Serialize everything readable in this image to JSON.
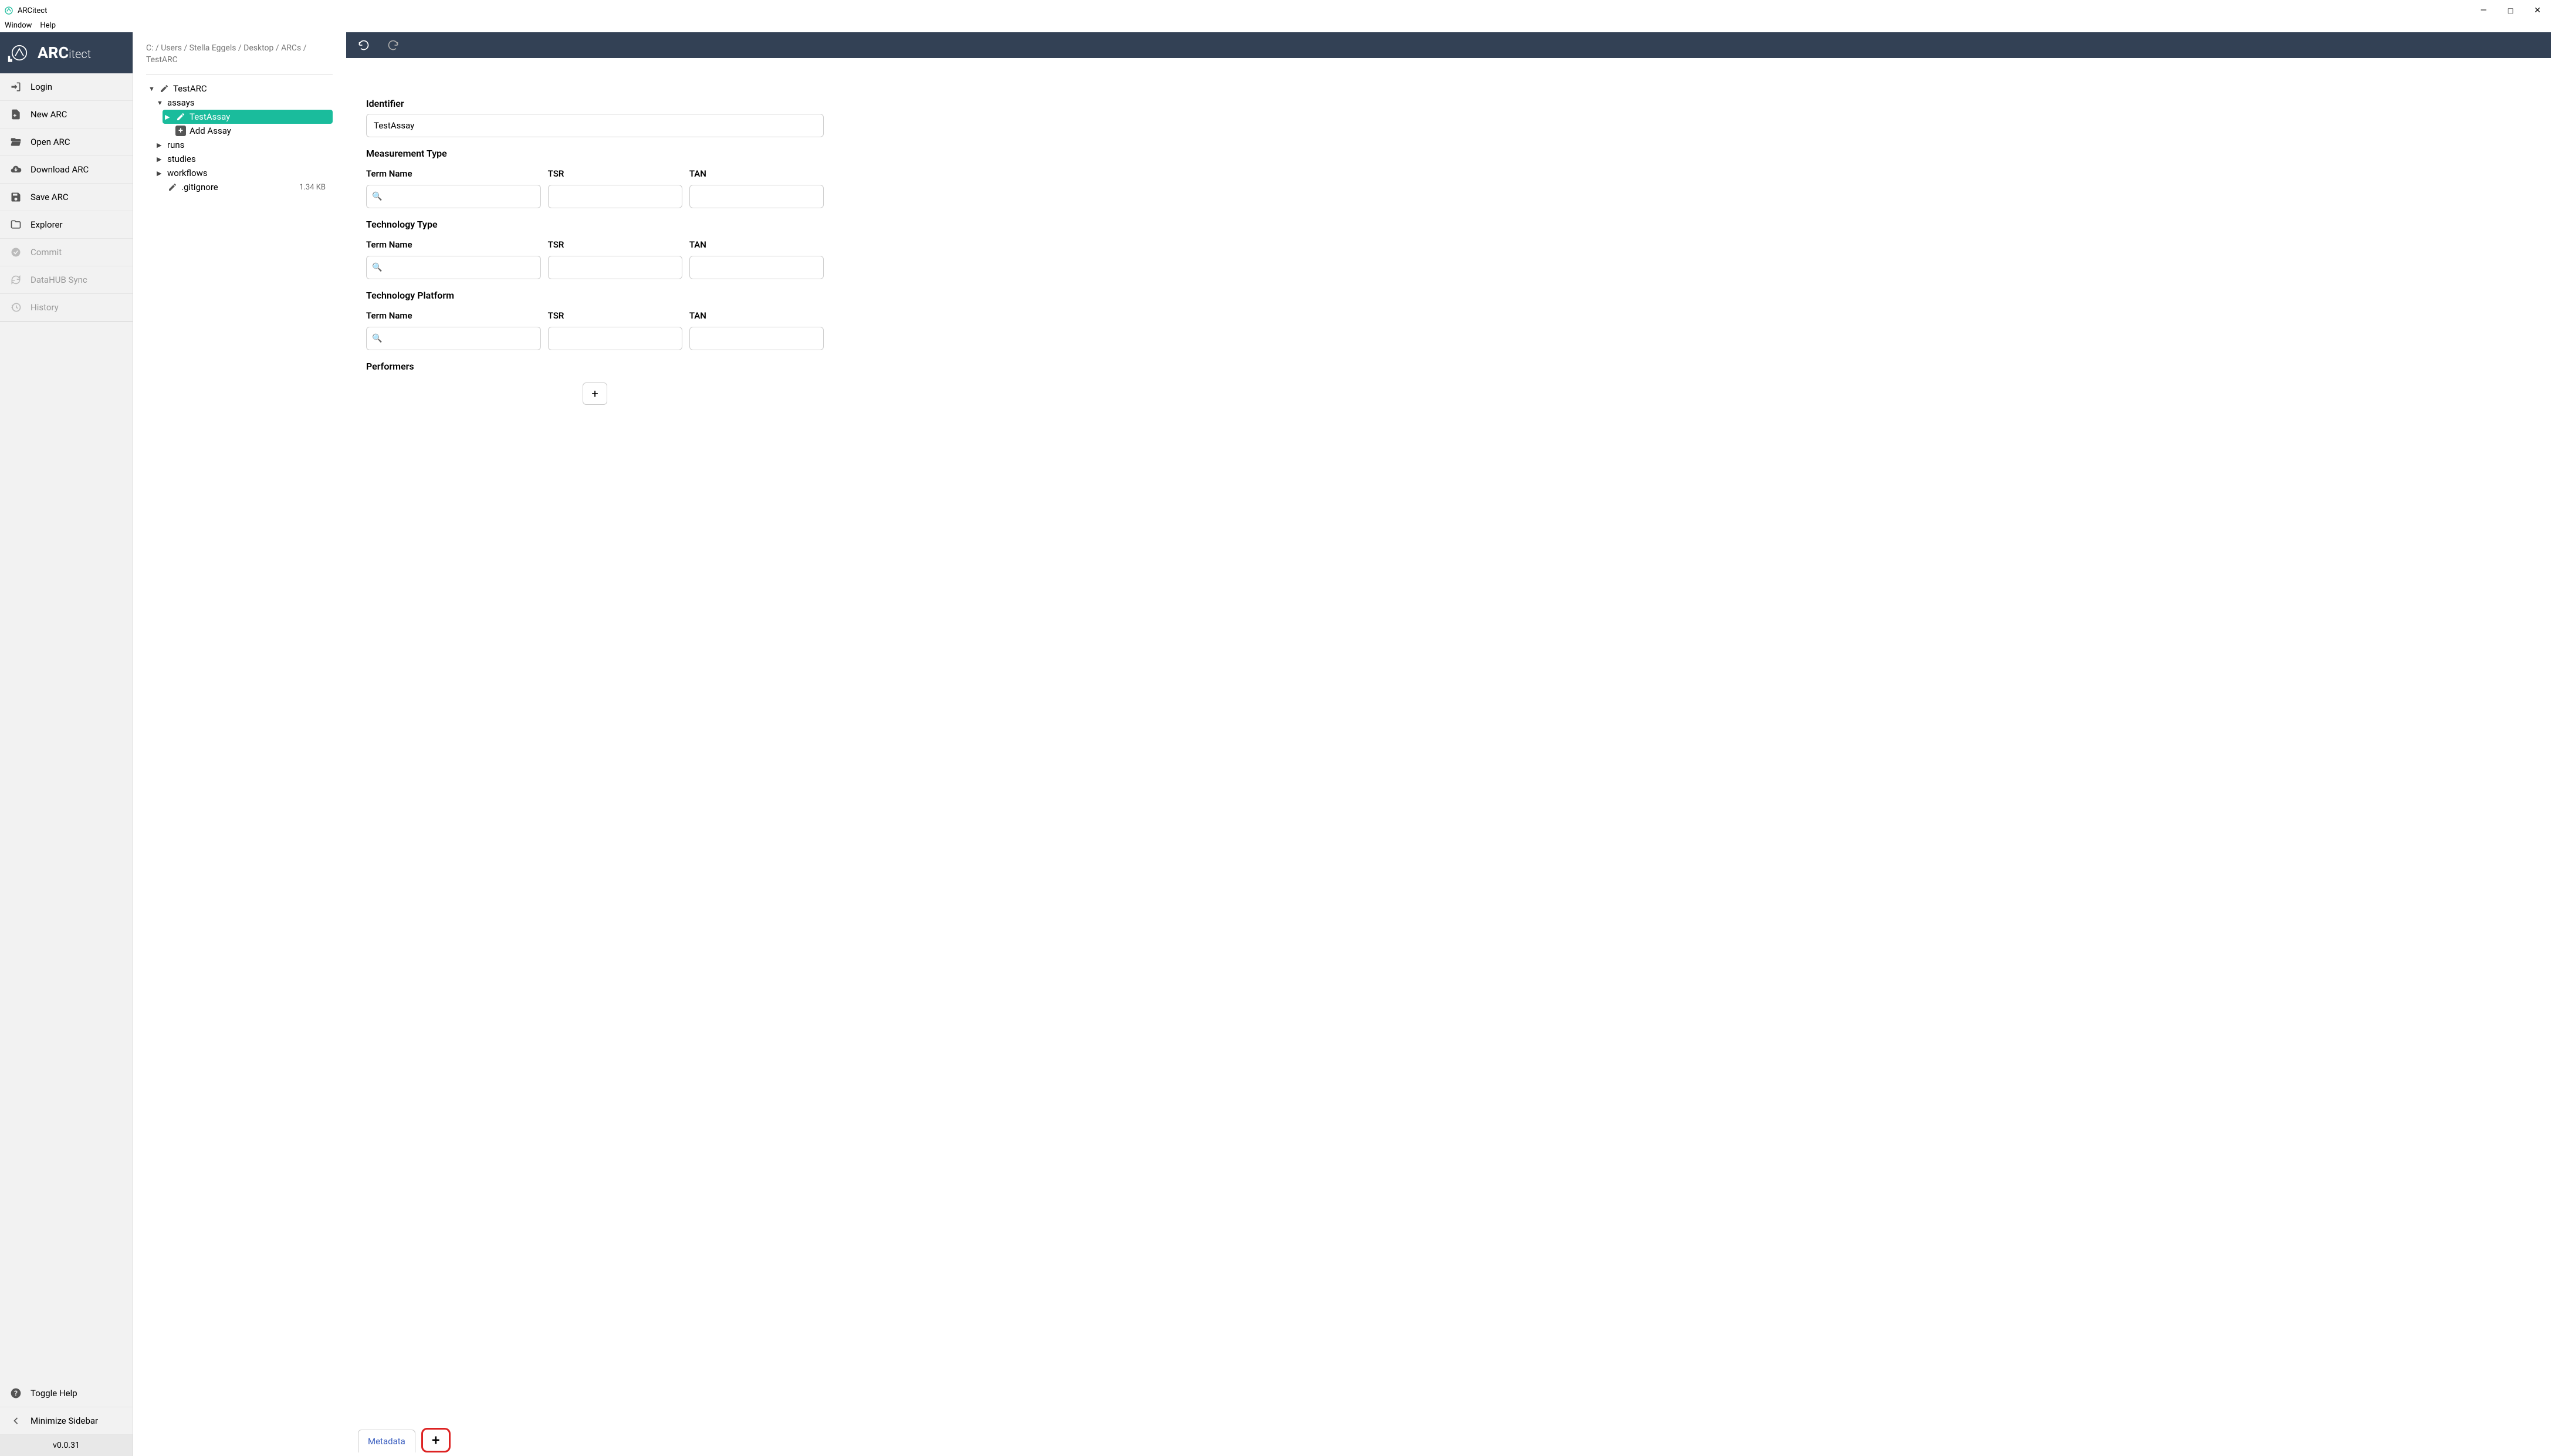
{
  "app": {
    "title": "ARCitect",
    "brand_big": "ARC",
    "brand_small": "itect"
  },
  "menubar": {
    "window": "Window",
    "help": "Help"
  },
  "sidebar": {
    "items": [
      {
        "label": "Login",
        "icon": "login-icon",
        "enabled": true
      },
      {
        "label": "New ARC",
        "icon": "file-plus-icon",
        "enabled": true
      },
      {
        "label": "Open ARC",
        "icon": "folder-open-icon",
        "enabled": true
      },
      {
        "label": "Download ARC",
        "icon": "cloud-download-icon",
        "enabled": true
      },
      {
        "label": "Save ARC",
        "icon": "save-icon",
        "enabled": true
      },
      {
        "label": "Explorer",
        "icon": "folder-icon",
        "enabled": true
      },
      {
        "label": "Commit",
        "icon": "check-badge-icon",
        "enabled": false
      },
      {
        "label": "DataHUB Sync",
        "icon": "sync-icon",
        "enabled": false
      },
      {
        "label": "History",
        "icon": "history-icon",
        "enabled": false
      }
    ],
    "footer": [
      {
        "label": "Toggle Help",
        "icon": "help-icon"
      },
      {
        "label": "Minimize Sidebar",
        "icon": "chevron-left-icon"
      }
    ],
    "version": "v0.0.31"
  },
  "breadcrumb": "C: / Users / Stella Eggels / Desktop / ARCs / TestARC",
  "tree": {
    "root": {
      "name": "TestARC",
      "open": true
    },
    "children": [
      {
        "name": "assays",
        "open": true,
        "children": [
          {
            "name": "TestAssay",
            "selected": true,
            "editable": true
          },
          {
            "name": "Add Assay",
            "add": true
          }
        ]
      },
      {
        "name": "runs"
      },
      {
        "name": "studies"
      },
      {
        "name": "workflows"
      },
      {
        "name": ".gitignore",
        "size": "1.34 KB",
        "editable": true,
        "leaf": true
      }
    ]
  },
  "form": {
    "identifier_label": "Identifier",
    "identifier_value": "TestAssay",
    "sections": [
      {
        "title": "Measurement Type",
        "cols": [
          "Term Name",
          "TSR",
          "TAN"
        ]
      },
      {
        "title": "Technology Type",
        "cols": [
          "Term Name",
          "TSR",
          "TAN"
        ]
      },
      {
        "title": "Technology Platform",
        "cols": [
          "Term Name",
          "TSR",
          "TAN"
        ]
      }
    ],
    "performers_label": "Performers"
  },
  "tabs": {
    "metadata": "Metadata"
  }
}
